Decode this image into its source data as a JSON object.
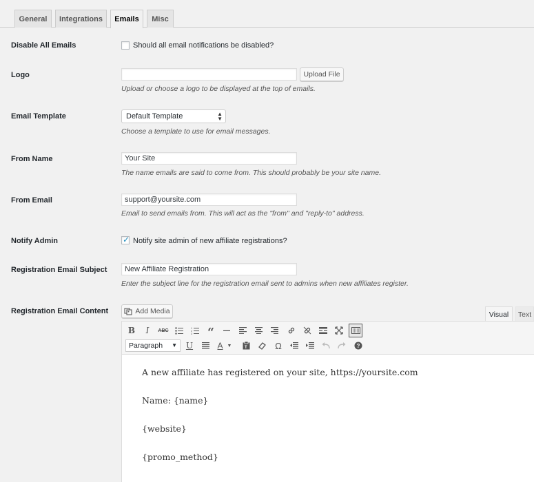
{
  "tabs": [
    "General",
    "Integrations",
    "Emails",
    "Misc"
  ],
  "active_tab": "Emails",
  "fields": {
    "disable_all": {
      "label": "Disable All Emails",
      "checkbox_label": "Should all email notifications be disabled?",
      "checked": false
    },
    "logo": {
      "label": "Logo",
      "value": "",
      "button": "Upload File",
      "description": "Upload or choose a logo to be displayed at the top of emails."
    },
    "template": {
      "label": "Email Template",
      "selected": "Default Template",
      "description": "Choose a template to use for email messages."
    },
    "from_name": {
      "label": "From Name",
      "value": "Your Site",
      "description": "The name emails are said to come from. This should probably be your site name."
    },
    "from_email": {
      "label": "From Email",
      "value": "support@yoursite.com",
      "description": "Email to send emails from. This will act as the \"from\" and \"reply-to\" address."
    },
    "notify_admin": {
      "label": "Notify Admin",
      "checkbox_label": "Notify site admin of new affiliate registrations?",
      "checked": true
    },
    "reg_subject": {
      "label": "Registration Email Subject",
      "value": "New Affiliate Registration",
      "description": "Enter the subject line for the registration email sent to admins when new affiliates register."
    },
    "reg_content": {
      "label": "Registration Email Content"
    }
  },
  "editor": {
    "add_media": "Add Media",
    "tab_visual": "Visual",
    "tab_text": "Text",
    "format": "Paragraph",
    "toolbar_row1": [
      "bold-icon",
      "italic-icon",
      "strikethrough-icon",
      "bullet-list-icon",
      "numbered-list-icon",
      "blockquote-icon",
      "horizontal-line-icon",
      "align-left-icon",
      "align-center-icon",
      "align-right-icon",
      "link-icon",
      "unlink-icon",
      "read-more-icon",
      "fullscreen-icon",
      "toolbar-toggle-icon"
    ],
    "toolbar_row2": [
      "underline-icon",
      "justify-icon",
      "text-color-icon",
      "paste-text-icon",
      "clear-formatting-icon",
      "special-character-icon",
      "outdent-icon",
      "indent-icon",
      "undo-icon",
      "redo-icon",
      "help-icon"
    ],
    "content": [
      "A new affiliate has registered on your site, https://yoursite.com",
      "Name: {name}",
      "{website}",
      "{promo_method}"
    ]
  }
}
